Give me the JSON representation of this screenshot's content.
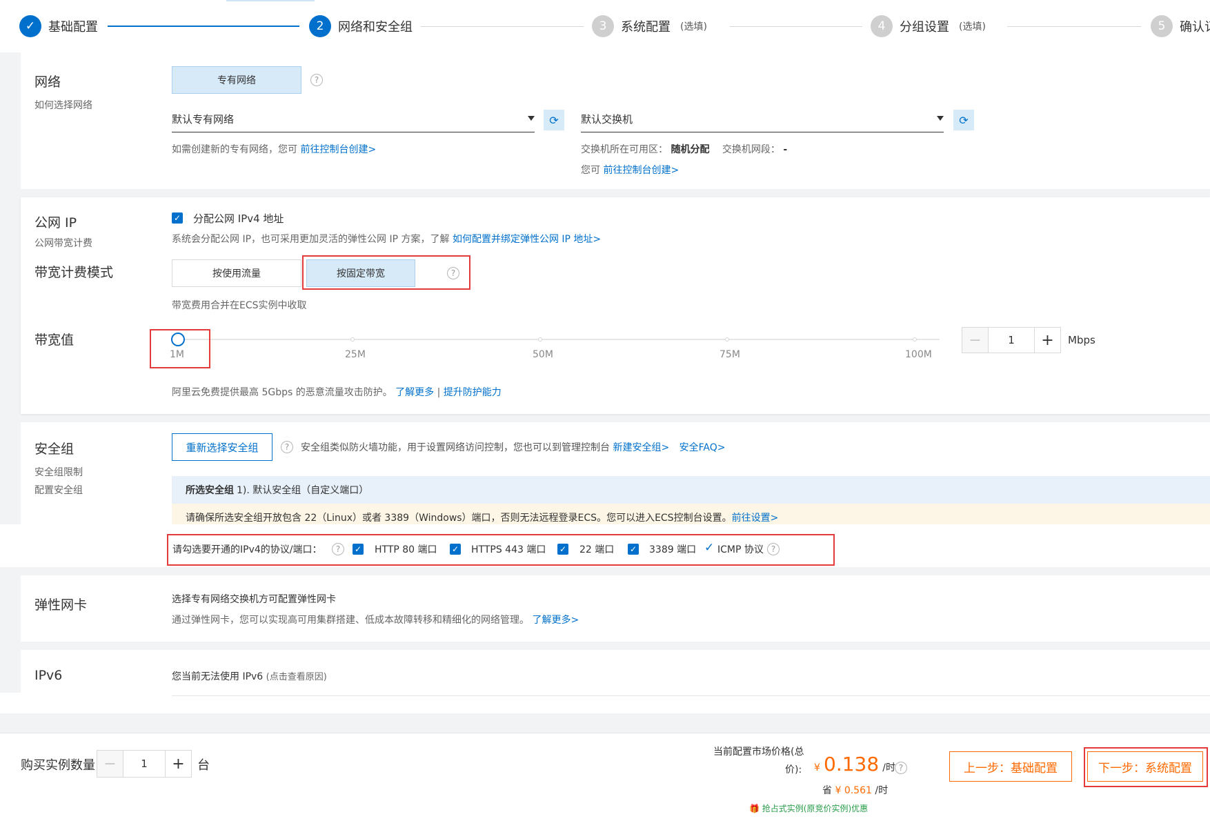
{
  "steps": [
    {
      "label": "基础配置",
      "num": "✓",
      "note": ""
    },
    {
      "label": "网络和安全组",
      "num": "2",
      "note": ""
    },
    {
      "label": "系统配置",
      "num": "3",
      "note": "(选填)"
    },
    {
      "label": "分组设置",
      "num": "4",
      "note": "(选填)"
    },
    {
      "label": "确认订",
      "num": "5",
      "note": ""
    }
  ],
  "network": {
    "title": "网络",
    "subtitle": "如何选择网络",
    "type_tab": "专有网络",
    "vpc_select": "默认专有网络",
    "vswitch_select": "默认交换机",
    "vpc_hint_prefix": "如需创建新的专有网络，您可",
    "vpc_hint_link": "前往控制台创建>",
    "zone_label": "交换机所在可用区：",
    "zone_value": "随机分配",
    "cidr_label": "交换机网段：",
    "cidr_value": "-",
    "vswitch_hint_prefix": "您可",
    "vswitch_hint_link": "前往控制台创建>"
  },
  "public_ip": {
    "title": "公网 IP",
    "subtitle": "公网带宽计费",
    "assign_label": "分配公网 IPv4 地址",
    "hint_prefix": "系统会分配公网 IP，也可采用更加灵活的弹性公网 IP 方案，了解",
    "hint_link": "如何配置并绑定弹性公网 IP 地址>",
    "billing_title": "带宽计费模式",
    "billing_options": [
      "按使用流量",
      "按固定带宽"
    ],
    "billing_note": "带宽费用合并在ECS实例中收取",
    "bandwidth_title": "带宽值",
    "slider_labels": [
      "1M",
      "25M",
      "50M",
      "75M",
      "100M"
    ],
    "slider_value": 1,
    "bandwidth_input": "1",
    "bandwidth_unit": "Mbps",
    "ddos_text": "阿里云免费提供最高 5Gbps 的恶意流量攻击防护。",
    "ddos_link1": "了解更多",
    "ddos_sep": "|",
    "ddos_link2": "提升防护能力"
  },
  "security_group": {
    "title": "安全组",
    "subtitle1": "安全组限制",
    "subtitle2": "配置安全组",
    "reselect_button": "重新选择安全组",
    "desc": "安全组类似防火墙功能，用于设置网络访问控制，您也可以到管理控制台",
    "link_new": "新建安全组>",
    "link_faq": "安全FAQ>",
    "selected_label": "所选安全组",
    "selected_value": "1). 默认安全组（自定义端口）",
    "warn_text": "请确保所选安全组开放包含 22（Linux）或者 3389（Windows）端口，否则无法远程登录ECS。您可以进入ECS控制台设置。",
    "warn_link": "前往设置>",
    "ports_label": "请勾选要开通的IPv4的协议/端口：",
    "ports": [
      "HTTP 80 端口",
      "HTTPS 443 端口",
      "22 端口",
      "3389 端口"
    ],
    "icmp_label": "ICMP 协议"
  },
  "eni": {
    "title": "弹性网卡",
    "line1": "选择专有网络交换机方可配置弹性网卡",
    "line2_prefix": "通过弹性网卡，您可以实现高可用集群搭建、低成本故障转移和精细化的网络管理。",
    "line2_link": "了解更多>"
  },
  "ipv6": {
    "title": "IPv6",
    "text": "您当前无法使用 IPv6",
    "note": "(点击查看原因)"
  },
  "footer": {
    "qty_label": "购买实例数量",
    "qty_value": "1",
    "qty_unit": "台",
    "price_label_1": "当前配置市场价格(总",
    "price_label_2": "价):",
    "currency": "¥",
    "price": "0.138",
    "price_unit": "/时",
    "save_label": "省",
    "save_currency": "¥",
    "save_value": "0.561",
    "save_unit": "/时",
    "promo": "抢占式实例(原竞价实例)优惠",
    "prev_button": "上一步：基础配置",
    "next_button": "下一步：系统配置"
  },
  "colors": {
    "primary": "#0070cc",
    "orange": "#ff6a00",
    "highlight_red": "#e53a3a",
    "green": "#2a9d4b"
  }
}
